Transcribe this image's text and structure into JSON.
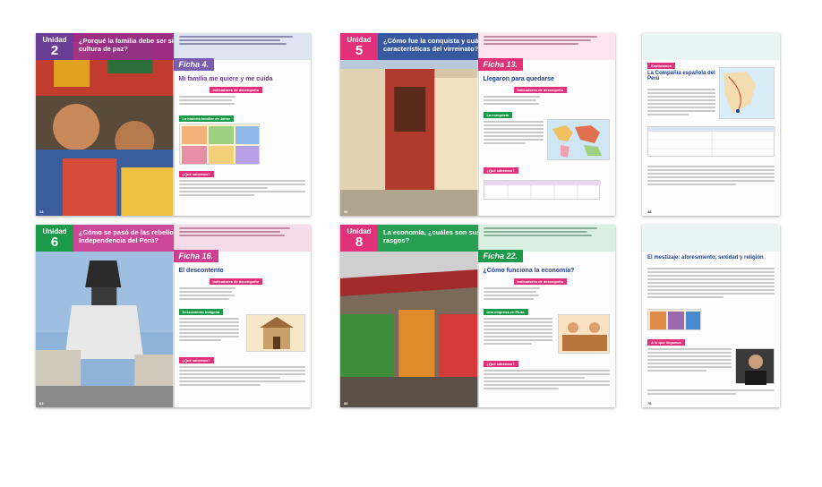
{
  "spreads": [
    {
      "unit_word": "Unidad",
      "unit_num": "2",
      "question": "¿Porqué la familia debe ser sinónimo de cultura de paz?",
      "ficha": "Ficha 4.",
      "title": "Mi familia me quiere y me cuida",
      "tag": "Indicadores de desempeño",
      "section": "La historia familiar de Jaime",
      "activity": "¿Qué sabemos?",
      "page": "14",
      "colors": {
        "band": "#9c2b8c",
        "ficha": "#7a5fb0",
        "accent": "#1b9b4a"
      }
    },
    {
      "unit_word": "Unidad",
      "unit_num": "5",
      "question": "¿Cómo fue la conquista y cuáles fueron las características del virreinato?",
      "ficha": "Ficha 13.",
      "title": "Llegaron para quedarse",
      "tag": "Indicadores de desempeño",
      "section": "La conquista",
      "activity": "¿Qué sabemos?",
      "page": "50",
      "colors": {
        "band": "#2b4f9c",
        "ficha": "#e0317a",
        "accent": "#1b9b4a"
      }
    },
    {
      "unit_word": "Unidad",
      "unit_num": "6",
      "question": "¿Cómo se pasó de las rebeliones a la Independencia del Perú?",
      "ficha": "Ficha 16.",
      "title": "El descontento",
      "tag": "Indicadores de desempeño",
      "section": "Descontento indígena",
      "activity": "¿Qué sabemos?",
      "page": "62",
      "colors": {
        "band": "#d13e92",
        "ficha": "#d13e92",
        "accent": "#1b9b4a"
      }
    },
    {
      "unit_word": "Unidad",
      "unit_num": "8",
      "question": "La economía, ¿cuáles son sus principales rasgos?",
      "ficha": "Ficha 22.",
      "title": "¿Cómo funciona la economía?",
      "tag": "Indicadores de desempeño",
      "section": "Una empresa en Piura",
      "activity": "¿Qué sabemos?",
      "page": "86",
      "colors": {
        "band": "#1b9b4a",
        "ficha": "#1b9b4a",
        "accent": "#1b9b4a"
      }
    }
  ],
  "singles": [
    {
      "title": "La Compañía española del Perú",
      "section": "Exploramos",
      "page": "48"
    },
    {
      "title": "El mestizaje: aforesmiento, sexidad y religión",
      "section": "A lo que llegamos",
      "page": "76"
    }
  ]
}
